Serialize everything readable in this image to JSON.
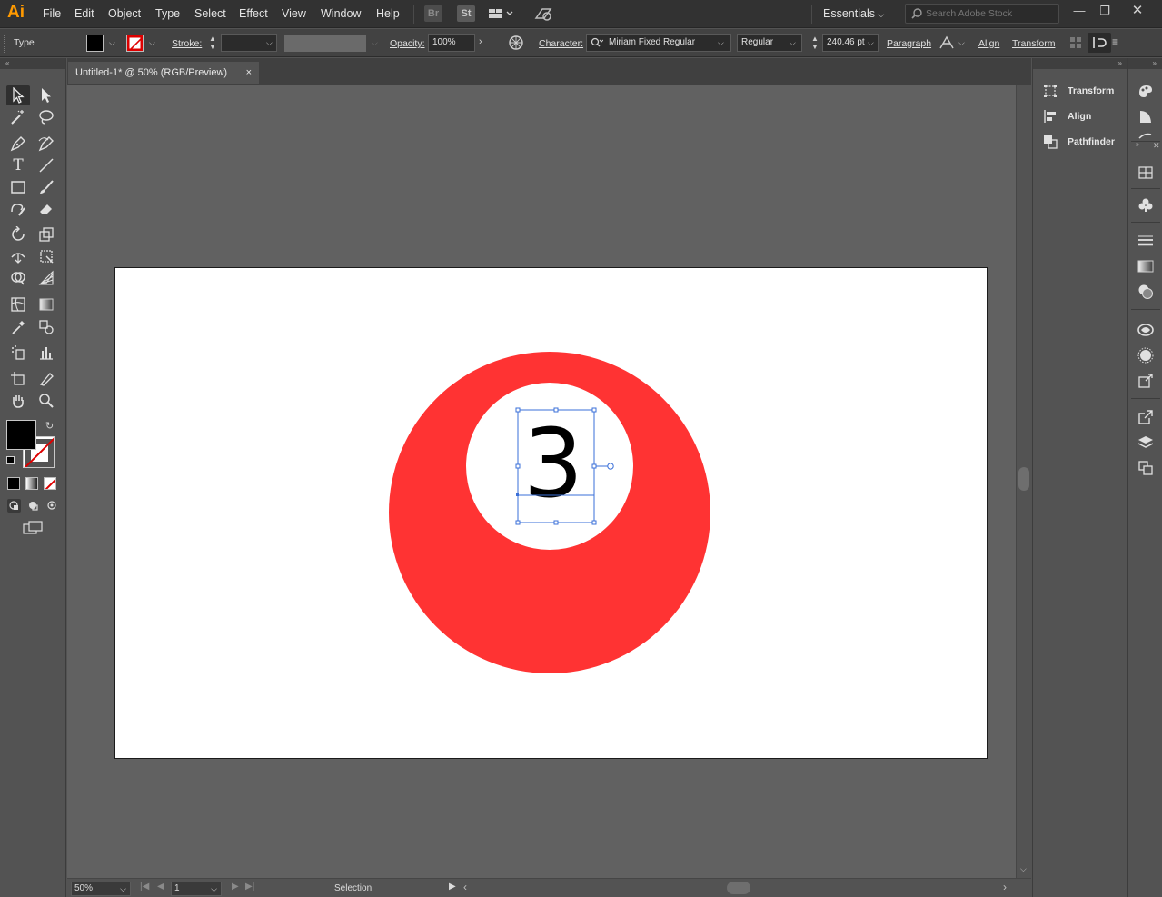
{
  "app": {
    "logo": "Ai",
    "accent": "#ff9a00"
  },
  "menu": [
    "File",
    "Edit",
    "Object",
    "Type",
    "Select",
    "Effect",
    "View",
    "Window",
    "Help"
  ],
  "menubar_buttons": {
    "bridge": "Br",
    "stock": "St"
  },
  "workspace": {
    "label": "Essentials"
  },
  "search": {
    "placeholder": "Search Adobe Stock"
  },
  "control_bar": {
    "mode_label": "Type",
    "stroke_label": "Stroke:",
    "opacity_label": "Opacity:",
    "opacity_value": "100%",
    "character_label": "Character:",
    "font_family": "Miriam Fixed Regular",
    "font_style": "Regular",
    "font_size": "240.46 pt",
    "paragraph_label": "Paragraph",
    "align_label": "Align",
    "transform_label": "Transform"
  },
  "document": {
    "tab_title": "Untitled-1* @ 50% (RGB/Preview)",
    "close_glyph": "×"
  },
  "artwork": {
    "ball_number": "3",
    "ball_color": "#ff3333",
    "inner_color": "#ffffff",
    "number_color": "#000000",
    "selection_color": "#3a6fd8"
  },
  "status": {
    "zoom": "50%",
    "page": "1",
    "tool": "Selection"
  },
  "panels": [
    {
      "label": "Transform",
      "icon": "transform-icon"
    },
    {
      "label": "Align",
      "icon": "align-icon"
    },
    {
      "label": "Pathfinder",
      "icon": "pathfinder-icon"
    }
  ],
  "colors": {
    "fill_swatch": "#000000",
    "stroke_swatch": "none"
  }
}
